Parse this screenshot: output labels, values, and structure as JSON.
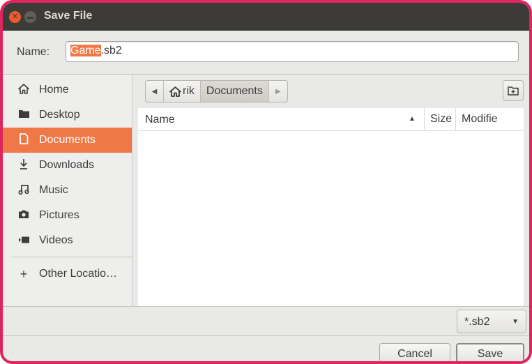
{
  "window": {
    "title": "Save File"
  },
  "name_field": {
    "label": "Name:",
    "value_selected": "Game",
    "value_rest": ".sb2"
  },
  "sidebar": {
    "items": [
      {
        "label": "Home",
        "icon": "home-icon"
      },
      {
        "label": "Desktop",
        "icon": "folder-icon"
      },
      {
        "label": "Documents",
        "icon": "document-icon",
        "active": true
      },
      {
        "label": "Downloads",
        "icon": "download-icon"
      },
      {
        "label": "Music",
        "icon": "music-icon"
      },
      {
        "label": "Pictures",
        "icon": "camera-icon"
      },
      {
        "label": "Videos",
        "icon": "video-icon"
      },
      {
        "label": "Other Locatio…",
        "icon": "plus-icon"
      }
    ]
  },
  "pathbar": {
    "home_segment": "rik",
    "current_segment": "Documents"
  },
  "file_list": {
    "columns": {
      "name": "Name",
      "size": "Size",
      "modified": "Modifie"
    },
    "rows": []
  },
  "filter": {
    "selected": "*.sb2"
  },
  "buttons": {
    "cancel": "Cancel",
    "save": "Save"
  },
  "colors": {
    "accent": "#f07746",
    "titlebar": "#3c3b37",
    "frame_border": "#e0245e"
  }
}
